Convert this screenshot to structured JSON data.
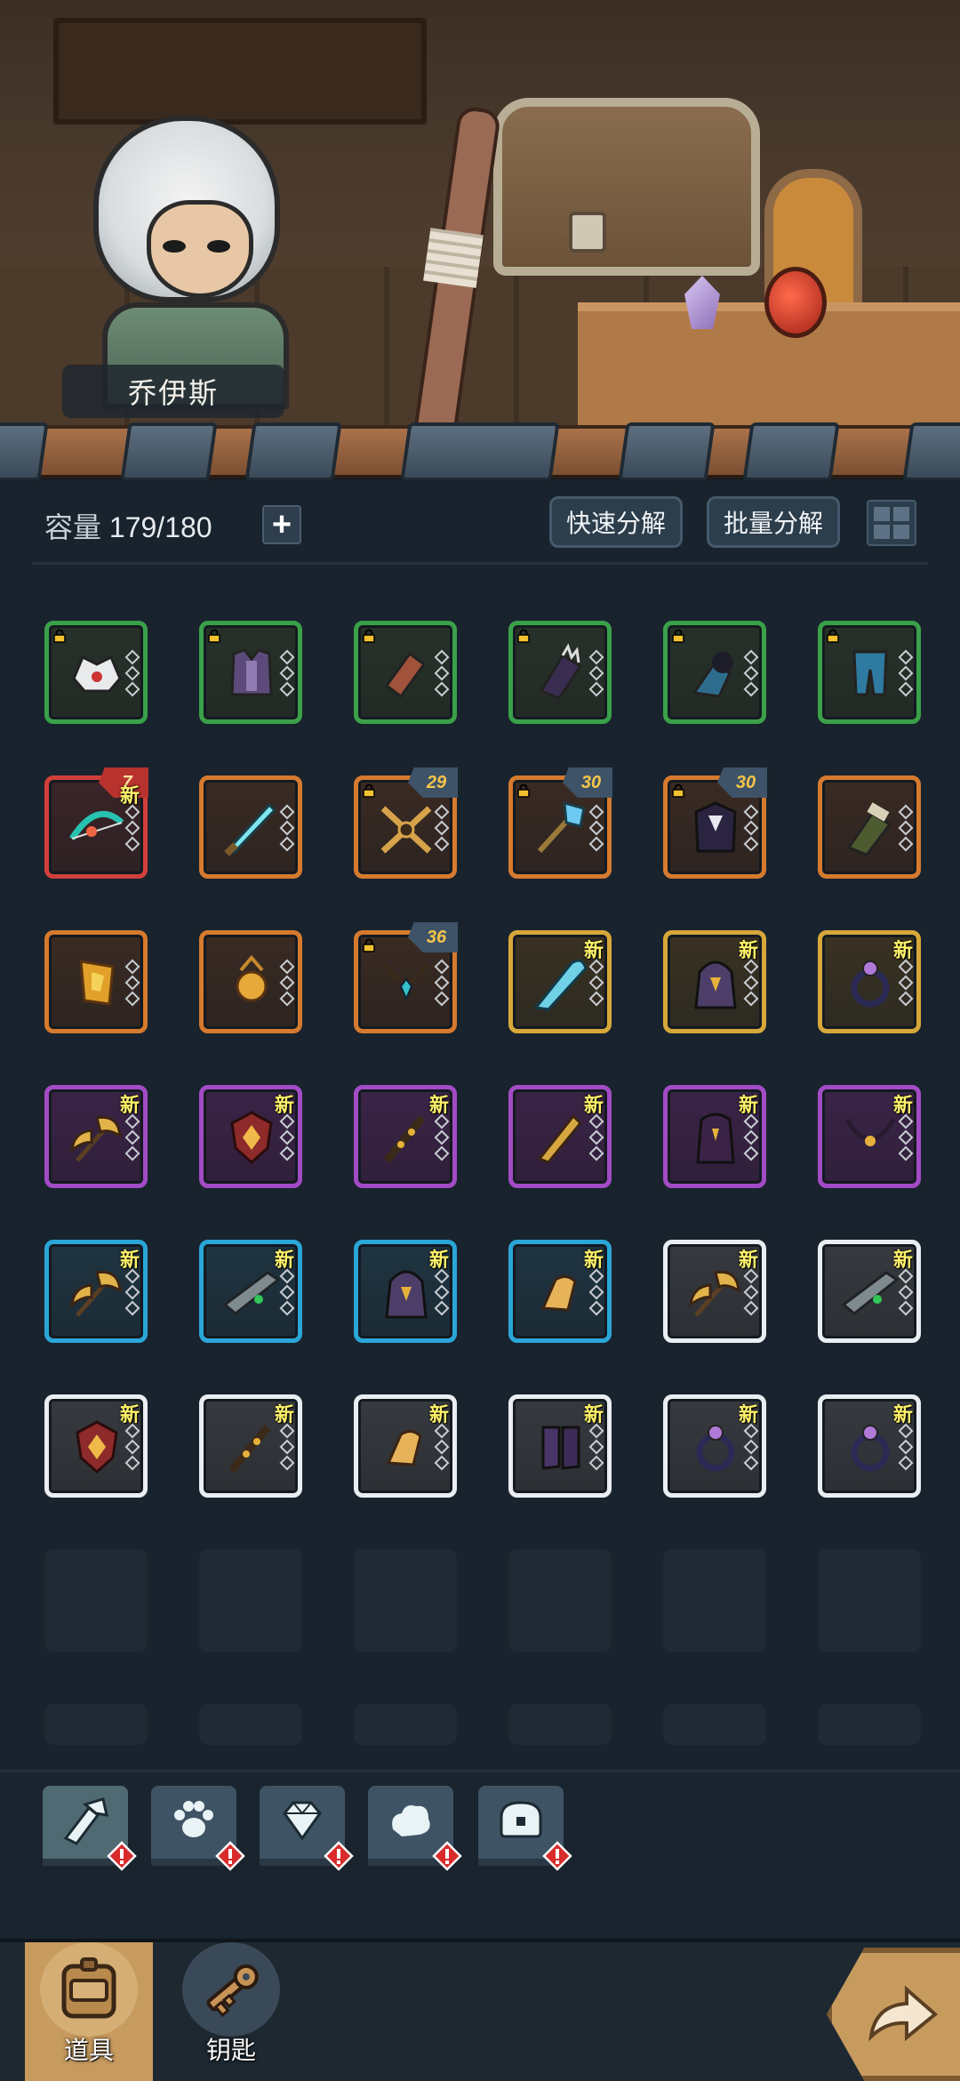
{
  "hero": {
    "name": "乔伊斯"
  },
  "header": {
    "capacity_label": "容量",
    "capacity_value": "179/180",
    "plus_symbol": "+",
    "quick_decompose_label": "快速分解",
    "batch_decompose_label": "批量分解"
  },
  "colors": {
    "green": "#3aa14a",
    "red": "#d1403a",
    "orange": "#d57a2e",
    "gold": "#d7a73b",
    "purple": "#a24bc5",
    "blue": "#2aa6d8",
    "white": "#e9eef2"
  },
  "inventory": [
    {
      "rarity": "green",
      "icon": "spiked-helmet-icon",
      "locked": true,
      "new": false,
      "level": ""
    },
    {
      "rarity": "green",
      "icon": "vest-armor-icon",
      "locked": true,
      "new": false,
      "level": ""
    },
    {
      "rarity": "green",
      "icon": "bracer-icon",
      "locked": true,
      "new": false,
      "level": ""
    },
    {
      "rarity": "green",
      "icon": "spiked-gauntlet-icon",
      "locked": true,
      "new": false,
      "level": ""
    },
    {
      "rarity": "green",
      "icon": "fur-boot-icon",
      "locked": true,
      "new": false,
      "level": ""
    },
    {
      "rarity": "green",
      "icon": "leg-armor-icon",
      "locked": true,
      "new": false,
      "level": ""
    },
    {
      "rarity": "red",
      "icon": "serpent-bow-icon",
      "locked": false,
      "new": true,
      "level": "7"
    },
    {
      "rarity": "orange",
      "icon": "ice-sword-icon",
      "locked": false,
      "new": false,
      "level": ""
    },
    {
      "rarity": "orange",
      "icon": "golden-crossbow-icon",
      "locked": true,
      "new": false,
      "level": "29"
    },
    {
      "rarity": "orange",
      "icon": "ice-staff-icon",
      "locked": true,
      "new": false,
      "level": "30"
    },
    {
      "rarity": "orange",
      "icon": "dark-cloak-icon",
      "locked": true,
      "new": false,
      "level": "30"
    },
    {
      "rarity": "orange",
      "icon": "green-gauntlet-icon",
      "locked": false,
      "new": false,
      "level": ""
    },
    {
      "rarity": "orange",
      "icon": "gold-armor-icon",
      "locked": false,
      "new": false,
      "level": ""
    },
    {
      "rarity": "orange",
      "icon": "gold-amulet-icon",
      "locked": false,
      "new": false,
      "level": ""
    },
    {
      "rarity": "orange",
      "icon": "teal-necklace-icon",
      "locked": true,
      "new": false,
      "level": "36"
    },
    {
      "rarity": "gold",
      "icon": "frost-blade-icon",
      "locked": false,
      "new": true,
      "level": ""
    },
    {
      "rarity": "gold",
      "icon": "hooded-robe-icon",
      "locked": false,
      "new": true,
      "level": ""
    },
    {
      "rarity": "gold",
      "icon": "dark-ring-icon",
      "locked": false,
      "new": true,
      "level": ""
    },
    {
      "rarity": "purple",
      "icon": "golden-axe-icon",
      "locked": false,
      "new": true,
      "level": ""
    },
    {
      "rarity": "purple",
      "icon": "crimson-shield-icon",
      "locked": false,
      "new": true,
      "level": ""
    },
    {
      "rarity": "purple",
      "icon": "spiked-club-icon",
      "locked": false,
      "new": true,
      "level": ""
    },
    {
      "rarity": "purple",
      "icon": "golden-dagger-icon",
      "locked": false,
      "new": true,
      "level": ""
    },
    {
      "rarity": "purple",
      "icon": "dark-robe-icon",
      "locked": false,
      "new": true,
      "level": ""
    },
    {
      "rarity": "purple",
      "icon": "dark-necklace-icon",
      "locked": false,
      "new": true,
      "level": ""
    },
    {
      "rarity": "blue",
      "icon": "golden-axe-icon",
      "locked": false,
      "new": true,
      "level": ""
    },
    {
      "rarity": "blue",
      "icon": "serrated-blade-icon",
      "locked": false,
      "new": true,
      "level": ""
    },
    {
      "rarity": "blue",
      "icon": "hooded-robe-icon",
      "locked": false,
      "new": true,
      "level": ""
    },
    {
      "rarity": "blue",
      "icon": "gold-glove-icon",
      "locked": false,
      "new": true,
      "level": ""
    },
    {
      "rarity": "white",
      "icon": "golden-axe-icon",
      "locked": false,
      "new": true,
      "level": ""
    },
    {
      "rarity": "white",
      "icon": "serrated-blade-icon",
      "locked": false,
      "new": true,
      "level": ""
    },
    {
      "rarity": "white",
      "icon": "crimson-shield-icon",
      "locked": false,
      "new": true,
      "level": ""
    },
    {
      "rarity": "white",
      "icon": "spiked-club-icon",
      "locked": false,
      "new": true,
      "level": ""
    },
    {
      "rarity": "white",
      "icon": "gold-glove-icon",
      "locked": false,
      "new": true,
      "level": ""
    },
    {
      "rarity": "white",
      "icon": "purple-boots-icon",
      "locked": false,
      "new": true,
      "level": ""
    },
    {
      "rarity": "white",
      "icon": "dark-ring-icon",
      "locked": false,
      "new": true,
      "level": ""
    },
    {
      "rarity": "white",
      "icon": "dark-ring-icon",
      "locked": false,
      "new": true,
      "level": ""
    }
  ],
  "new_label": "新",
  "empty_slots_visible": 12,
  "categories": [
    {
      "icon": "weapon-category-icon",
      "alert": true
    },
    {
      "icon": "paw-category-icon",
      "alert": true
    },
    {
      "icon": "gem-category-icon",
      "alert": true
    },
    {
      "icon": "ore-category-icon",
      "alert": true
    },
    {
      "icon": "chest-category-icon",
      "alert": true
    }
  ],
  "bottom_nav": {
    "items_label": "道具",
    "keys_label": "钥匙"
  }
}
